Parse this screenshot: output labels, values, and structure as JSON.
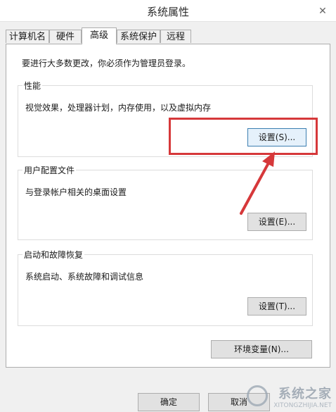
{
  "window": {
    "title": "系统属性",
    "close_glyph": "✕"
  },
  "tabs": [
    {
      "label": "计算机名",
      "active": false
    },
    {
      "label": "硬件",
      "active": false
    },
    {
      "label": "高级",
      "active": true
    },
    {
      "label": "系统保护",
      "active": false
    },
    {
      "label": "远程",
      "active": false
    }
  ],
  "panel": {
    "admin_note": "要进行大多数更改，你必须作为管理员登录。",
    "performance": {
      "title": "性能",
      "description": "视觉效果，处理器计划，内存使用，以及虚拟内存",
      "button": "设置(S)..."
    },
    "user_profiles": {
      "title": "用户配置文件",
      "description": "与登录帐户相关的桌面设置",
      "button": "设置(E)..."
    },
    "startup_recovery": {
      "title": "启动和故障恢复",
      "description": "系统启动、系统故障和调试信息",
      "button": "设置(T)..."
    },
    "env_button": "环境变量(N)..."
  },
  "footer": {
    "ok_button": "确定",
    "cancel_button_partial": "取消"
  },
  "annotation": {
    "highlight_color": "#d6383a"
  },
  "watermark": {
    "brand": "系统之家",
    "url": "XITONGZHIJIA.NET"
  }
}
